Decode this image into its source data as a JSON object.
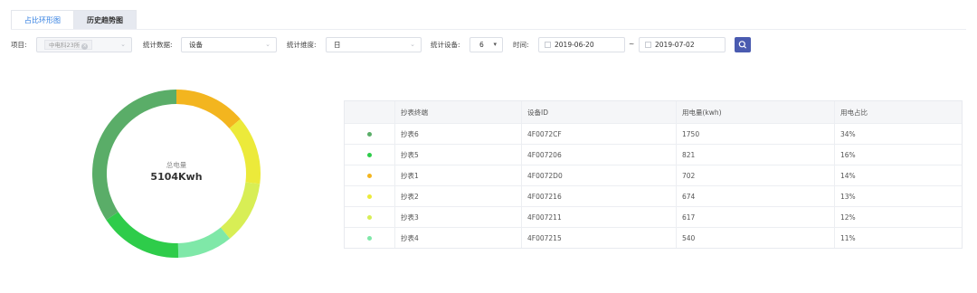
{
  "tabs": [
    {
      "label": "占比环形图",
      "active": true
    },
    {
      "label": "历史趋势图",
      "active": false
    }
  ],
  "filters": {
    "project_label": "项目:",
    "project_tag": "中电科23所",
    "data_label": "统计数据:",
    "data_value": "设备",
    "dimension_label": "统计维度:",
    "dimension_value": "日",
    "device_label": "统计设备:",
    "device_value": "6",
    "time_label": "时间:",
    "start_date": "2019-06-20",
    "range_sep": "~",
    "end_date": "2019-07-02"
  },
  "donut": {
    "title": "总电量",
    "total": "5104Kwh"
  },
  "table": {
    "headers": [
      "",
      "抄表终端",
      "设备ID",
      "用电量(kwh)",
      "用电占比"
    ],
    "rows": [
      {
        "color": "#5aad68",
        "terminal": "抄表6",
        "device_id": "4F0072CF",
        "kwh": "1750",
        "pct": "34%"
      },
      {
        "color": "#2ecc4a",
        "terminal": "抄表5",
        "device_id": "4F007206",
        "kwh": "821",
        "pct": "16%"
      },
      {
        "color": "#f3b51f",
        "terminal": "抄表1",
        "device_id": "4F0072D0",
        "kwh": "702",
        "pct": "14%"
      },
      {
        "color": "#ecea3a",
        "terminal": "抄表2",
        "device_id": "4F007216",
        "kwh": "674",
        "pct": "13%"
      },
      {
        "color": "#d8ee55",
        "terminal": "抄表3",
        "device_id": "4F007211",
        "kwh": "617",
        "pct": "12%"
      },
      {
        "color": "#7fe8a8",
        "terminal": "抄表4",
        "device_id": "4F007215",
        "kwh": "540",
        "pct": "11%"
      }
    ]
  },
  "chart_data": {
    "type": "pie",
    "categories": [
      "抄表1",
      "抄表2",
      "抄表3",
      "抄表4",
      "抄表5",
      "抄表6"
    ],
    "values": [
      702,
      674,
      617,
      540,
      821,
      1750
    ],
    "colors": [
      "#f3b51f",
      "#ecea3a",
      "#d8ee55",
      "#7fe8a8",
      "#2ecc4a",
      "#5aad68"
    ]
  }
}
